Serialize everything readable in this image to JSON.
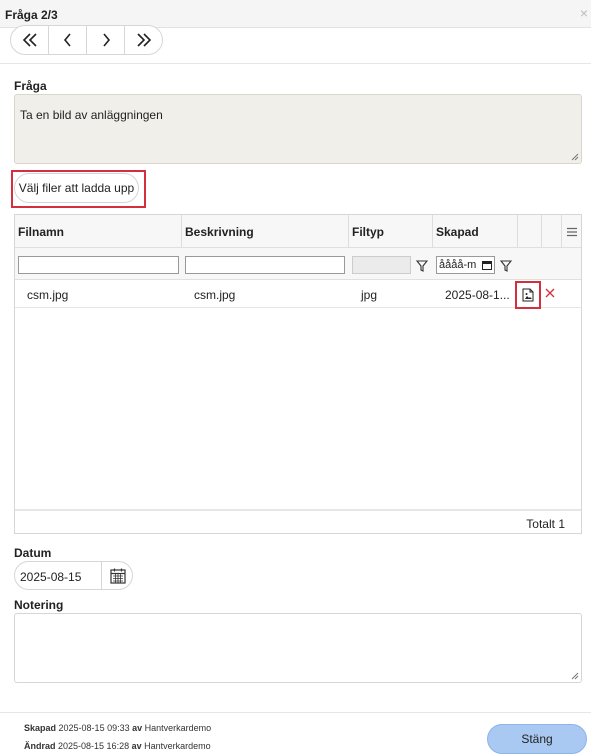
{
  "window": {
    "title": "Fråga 2/3",
    "close_glyph": "×"
  },
  "nav": {
    "first": "«",
    "prev": "‹",
    "next": "›",
    "last": "»"
  },
  "question": {
    "label": "Fråga",
    "text": "Ta en bild av anläggningen"
  },
  "upload": {
    "label": "Välj filer att ladda upp"
  },
  "grid": {
    "columns": [
      "Filnamn",
      "Beskrivning",
      "Filtyp",
      "Skapad"
    ],
    "date_filter_placeholder": "åååå-m",
    "rows": [
      {
        "filnamn": "csm.jpg",
        "beskrivning": "csm.jpg",
        "filtyp": "jpg",
        "skapad": "2025-08-1..."
      }
    ],
    "total": "Totalt 1"
  },
  "date": {
    "label": "Datum",
    "value": "2025-08-15"
  },
  "note": {
    "label": "Notering"
  },
  "meta": {
    "created_label": "Skapad",
    "created_value": "2025-08-15 09:33",
    "created_by_label": "av",
    "created_by": "Hantverkardemo",
    "changed_label": "Ändrad",
    "changed_value": "2025-08-15 16:28",
    "changed_by_label": "av",
    "changed_by": "Hantverkardemo"
  },
  "close_button": "Stäng",
  "colors": {
    "highlight": "#d32f3e",
    "primary_button": "#a9c8f2"
  },
  "icons": [
    "chevrons-left-icon",
    "chevron-left-icon",
    "chevron-right-icon",
    "chevrons-right-icon",
    "filter-icon",
    "calendar-icon",
    "file-image-icon",
    "delete-x-icon",
    "menu-icon"
  ]
}
